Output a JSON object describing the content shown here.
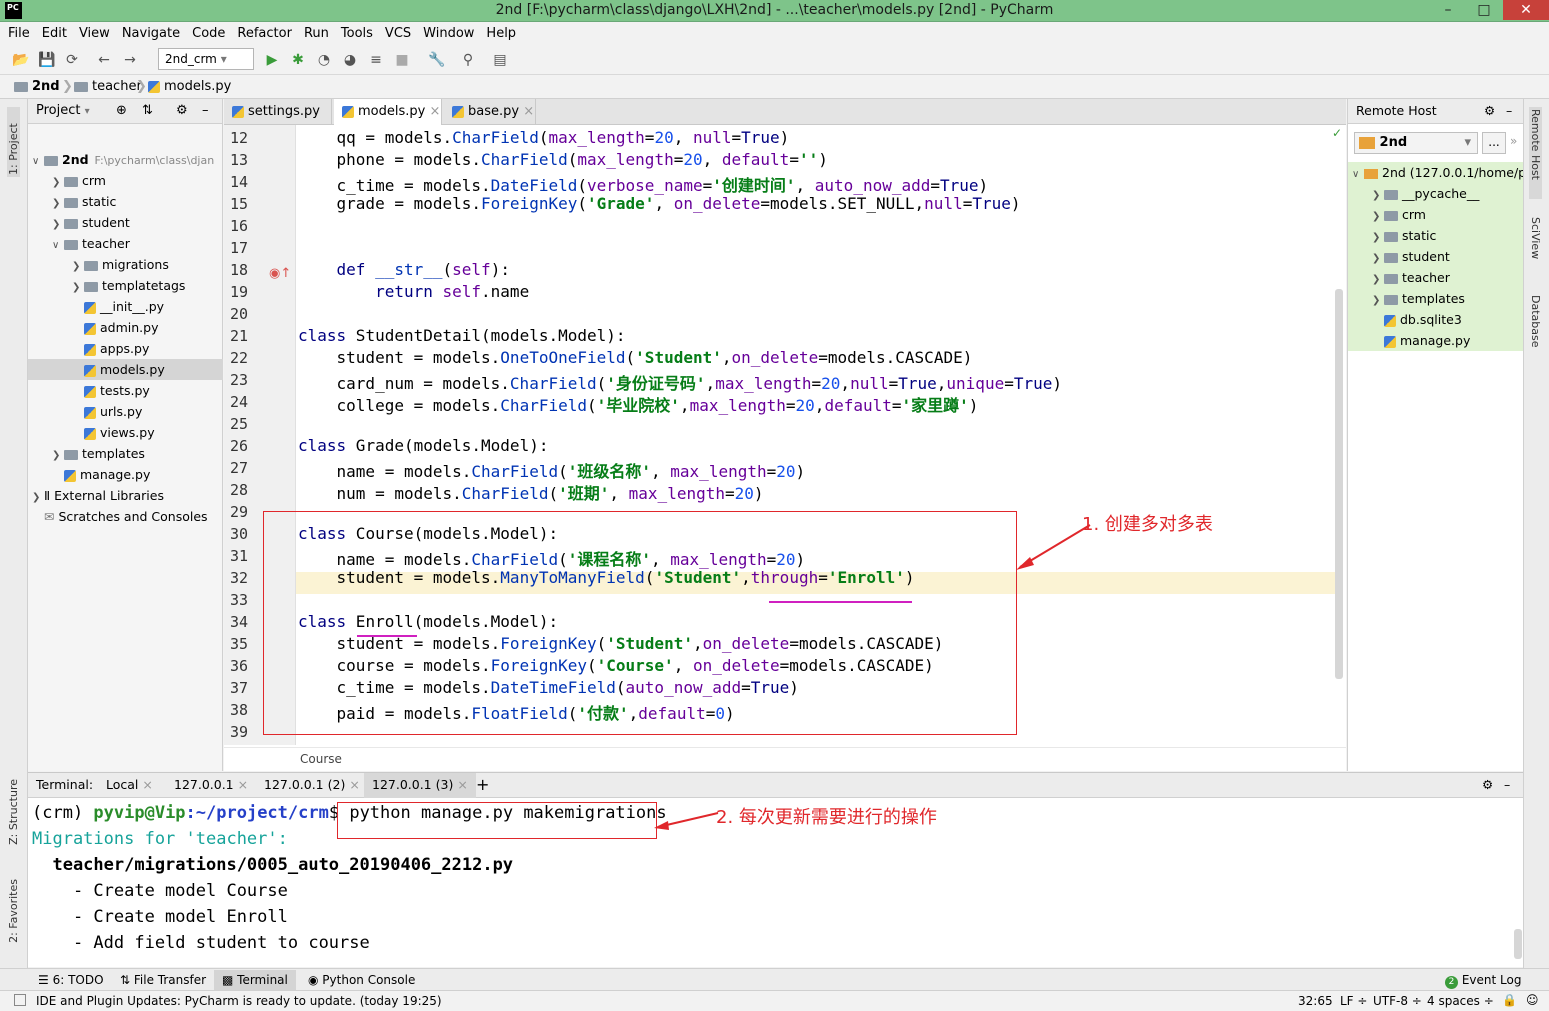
{
  "window": {
    "title": "2nd [F:\\pycharm\\class\\django\\LXH\\2nd] - ...\\teacher\\models.py [2nd] - PyCharm",
    "app_icon": "PC"
  },
  "menu": [
    "File",
    "Edit",
    "View",
    "Navigate",
    "Code",
    "Refactor",
    "Run",
    "Tools",
    "VCS",
    "Window",
    "Help"
  ],
  "toolbar": {
    "run_config": "2nd_crm"
  },
  "navbar": [
    "2nd",
    "teacher",
    "models.py"
  ],
  "project_panel": {
    "header": "Project",
    "items": [
      {
        "label": "2nd",
        "suffix": "F:\\pycharm\\class\\djan",
        "type": "folder"
      },
      {
        "label": "crm",
        "type": "folder"
      },
      {
        "label": "static",
        "type": "folder"
      },
      {
        "label": "student",
        "type": "folder"
      },
      {
        "label": "teacher",
        "type": "folder"
      },
      {
        "label": "migrations",
        "type": "folder"
      },
      {
        "label": "templatetags",
        "type": "folder"
      },
      {
        "label": "__init__.py",
        "type": "py"
      },
      {
        "label": "admin.py",
        "type": "py"
      },
      {
        "label": "apps.py",
        "type": "py"
      },
      {
        "label": "models.py",
        "type": "py"
      },
      {
        "label": "tests.py",
        "type": "py"
      },
      {
        "label": "urls.py",
        "type": "py"
      },
      {
        "label": "views.py",
        "type": "py"
      },
      {
        "label": "templates",
        "type": "folder"
      },
      {
        "label": "manage.py",
        "type": "py"
      },
      {
        "label": "External Libraries",
        "type": "lib"
      },
      {
        "label": "Scratches and Consoles",
        "type": "scratch"
      }
    ]
  },
  "left_strip": {
    "project": "1: Project",
    "structure": "Z: Structure",
    "favorites": "2: Favorites"
  },
  "right_strip": {
    "remote": "Remote Host",
    "sciview": "SciView",
    "database": "Database"
  },
  "tabs": [
    {
      "label": "settings.py"
    },
    {
      "label": "models.py"
    },
    {
      "label": "base.py"
    }
  ],
  "code_lines": [
    {
      "n": "12",
      "html": "    qq = models.<span class=\"fn\">CharField</span>(<span class=\"kwarg\">max_length</span>=<span class=\"num\">20</span>, <span class=\"kwarg\">null</span>=<span class=\"kw\">True</span>)"
    },
    {
      "n": "13",
      "html": "    phone = models.<span class=\"fn\">CharField</span>(<span class=\"kwarg\">max_length</span>=<span class=\"num\">20</span>, <span class=\"kwarg\">default</span>=<span class=\"str\">''</span>)"
    },
    {
      "n": "14",
      "html": "    c_time = models.<span class=\"fn\">DateField</span>(<span class=\"kwarg\">verbose_name</span>=<span class=\"str\">'创建时间'</span>, <span class=\"kwarg\">auto_now_add</span>=<span class=\"kw\">True</span>)"
    },
    {
      "n": "15",
      "html": "    grade = models.<span class=\"fn\">ForeignKey</span>(<span class=\"str\">'Grade'</span>, <span class=\"kwarg\">on_delete</span>=models.SET_NULL,<span class=\"kwarg\">null</span>=<span class=\"kw\">True</span>)"
    },
    {
      "n": "16",
      "html": ""
    },
    {
      "n": "17",
      "html": ""
    },
    {
      "n": "18",
      "html": "    <span class=\"kw\">def</span> <span class=\"fn\">__str__</span>(<span class=\"kwarg\">self</span>):"
    },
    {
      "n": "19",
      "html": "        <span class=\"kw\">return</span> <span class=\"kwarg\">self</span>.name"
    },
    {
      "n": "20",
      "html": ""
    },
    {
      "n": "21",
      "html": "<span class=\"kw\">class</span> StudentDetail(models.Model):"
    },
    {
      "n": "22",
      "html": "    student = models.<span class=\"fn\">OneToOneField</span>(<span class=\"str\">'Student'</span>,<span class=\"kwarg\">on_delete</span>=models.CASCADE)"
    },
    {
      "n": "23",
      "html": "    card_num = models.<span class=\"fn\">CharField</span>(<span class=\"str\">'身份证号码'</span>,<span class=\"kwarg\">max_length</span>=<span class=\"num\">20</span>,<span class=\"kwarg\">null</span>=<span class=\"kw\">True</span>,<span class=\"kwarg\">unique</span>=<span class=\"kw\">True</span>)"
    },
    {
      "n": "24",
      "html": "    college = models.<span class=\"fn\">CharField</span>(<span class=\"str\">'毕业院校'</span>,<span class=\"kwarg\">max_length</span>=<span class=\"num\">20</span>,<span class=\"kwarg\">default</span>=<span class=\"str\">'家里蹲'</span>)"
    },
    {
      "n": "25",
      "html": ""
    },
    {
      "n": "26",
      "html": "<span class=\"kw\">class</span> Grade(models.Model):"
    },
    {
      "n": "27",
      "html": "    name = models.<span class=\"fn\">CharField</span>(<span class=\"str\">'班级名称'</span>, <span class=\"kwarg\">max_length</span>=<span class=\"num\">20</span>)"
    },
    {
      "n": "28",
      "html": "    num = models.<span class=\"fn\">CharField</span>(<span class=\"str\">'班期'</span>, <span class=\"kwarg\">max_length</span>=<span class=\"num\">20</span>)"
    },
    {
      "n": "29",
      "html": ""
    },
    {
      "n": "30",
      "html": "<span class=\"kw\">class</span> Course(models.Model):"
    },
    {
      "n": "31",
      "html": "    name = models.<span class=\"fn\">CharField</span>(<span class=\"str\">'课程名称'</span>, <span class=\"kwarg\">max_length</span>=<span class=\"num\">20</span>)"
    },
    {
      "n": "32",
      "html": "    student = models.<span class=\"fn\">ManyToManyField</span>(<span class=\"str\">'Student'</span>,<span class=\"kwarg\">through</span>=<span class=\"str\">'Enroll'</span>)"
    },
    {
      "n": "33",
      "html": ""
    },
    {
      "n": "34",
      "html": "<span class=\"kw\">class</span> Enroll(models.Model):"
    },
    {
      "n": "35",
      "html": "    student = models.<span class=\"fn\">ForeignKey</span>(<span class=\"str\">'Student'</span>,<span class=\"kwarg\">on_delete</span>=models.CASCADE)"
    },
    {
      "n": "36",
      "html": "    course = models.<span class=\"fn\">ForeignKey</span>(<span class=\"str\">'Course'</span>, <span class=\"kwarg\">on_delete</span>=models.CASCADE)"
    },
    {
      "n": "37",
      "html": "    c_time = models.<span class=\"fn\">DateTimeField</span>(<span class=\"kwarg\">auto_now_add</span>=<span class=\"kw\">True</span>)"
    },
    {
      "n": "38",
      "html": "    paid = models.<span class=\"fn\">FloatField</span>(<span class=\"str\">'付款'</span>,<span class=\"kwarg\">default</span>=<span class=\"num\">0</span>)"
    },
    {
      "n": "39",
      "html": ""
    }
  ],
  "editor_breadcrumb": "Course",
  "annotations": {
    "a1": "1. 创建多对多表",
    "a2": "2. 每次更新需要进行的操作"
  },
  "remote_panel": {
    "header": "Remote Host",
    "server": "2nd",
    "root": "2nd (127.0.0.1/home/py",
    "items": [
      "__pycache__",
      "crm",
      "static",
      "student",
      "teacher",
      "templates",
      "db.sqlite3",
      "manage.py"
    ]
  },
  "terminal": {
    "label": "Terminal:",
    "tabs": [
      "Local",
      "127.0.0.1",
      "127.0.0.1 (2)",
      "127.0.0.1 (3)"
    ],
    "prompt_env": "(crm) ",
    "prompt_user": "pyvip@Vip",
    "prompt_path": ":~/project/crm",
    "prompt_sign": "$ ",
    "command": "python manage.py makemigrations",
    "lines": [
      "Migrations for 'teacher':",
      "  teacher/migrations/0005_auto_20190406_2212.py",
      "    - Create model Course",
      "    - Create model Enroll",
      "    - Add field student to course"
    ]
  },
  "bottom_tools": {
    "todo": "6: TODO",
    "file_transfer": "File Transfer",
    "terminal": "Terminal",
    "python_console": "Python Console",
    "event_log": "Event Log",
    "event_count": "2"
  },
  "status": {
    "message": "IDE and Plugin Updates: PyCharm is ready to update. (today 19:25)",
    "position": "32:65",
    "line_sep": "LF ÷",
    "encoding": "UTF-8 ÷",
    "indent": "4 spaces ÷"
  },
  "colors": {
    "title_bg": "#7ec48a",
    "highlight_line": "#fbf3d4",
    "annotation": "#e0272b",
    "remote_selected": "#dff2d2"
  }
}
